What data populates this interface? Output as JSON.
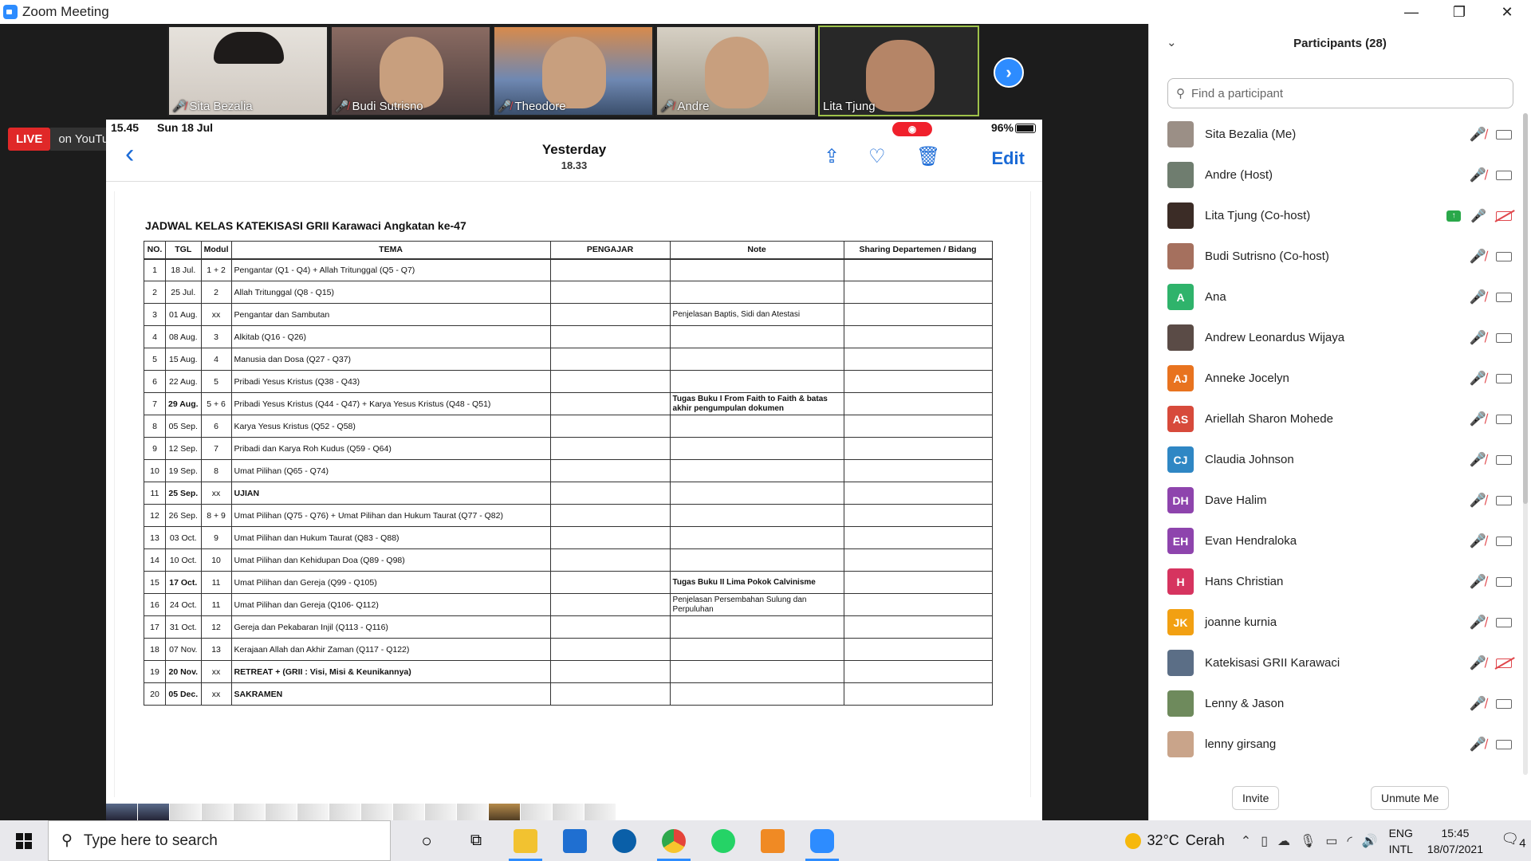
{
  "window": {
    "title": "Zoom Meeting"
  },
  "controls": {
    "minimize": "—",
    "maximize": "❐",
    "close": "✕"
  },
  "gallery": {
    "tiles": [
      {
        "name": "Sita Bezalia",
        "muted": true
      },
      {
        "name": "Budi Sutrisno",
        "muted": true
      },
      {
        "name": "Theodore",
        "muted": true
      },
      {
        "name": "Andre",
        "muted": true
      },
      {
        "name": "Lita Tjung",
        "muted": false
      }
    ],
    "next_icon": "›"
  },
  "live": {
    "badge": "LIVE",
    "platform": "on YouTube"
  },
  "phone": {
    "status_time": "15.45",
    "status_date": "Sun 18 Jul",
    "battery": "96%",
    "nav_title": "Yesterday",
    "nav_subtitle": "18.33",
    "edit": "Edit",
    "back": "‹"
  },
  "document": {
    "title": "JADWAL KELAS KATEKISASI GRII Karawaci Angkatan ke-47",
    "headers": [
      "NO.",
      "TGL",
      "Modul",
      "TEMA",
      "PENGAJAR",
      "Note",
      "Sharing Departemen / Bidang"
    ],
    "rows": [
      {
        "no": "1",
        "tgl": "18 Jul.",
        "modul": "1 + 2",
        "tema": "Pengantar (Q1 - Q4) + Allah Tritunggal (Q5 - Q7)",
        "note": "",
        "bold_tgl": false,
        "bold_tema": false
      },
      {
        "no": "2",
        "tgl": "25 Jul.",
        "modul": "2",
        "tema": "Allah Tritunggal (Q8 - Q15)",
        "note": "",
        "bold_tgl": false,
        "bold_tema": false
      },
      {
        "no": "3",
        "tgl": "01 Aug.",
        "modul": "xx",
        "tema": "Pengantar dan Sambutan",
        "note": "Penjelasan Baptis, Sidi dan Atestasi",
        "bold_tgl": false,
        "bold_tema": false
      },
      {
        "no": "4",
        "tgl": "08 Aug.",
        "modul": "3",
        "tema": "Alkitab (Q16 - Q26)",
        "note": "",
        "bold_tgl": false,
        "bold_tema": false
      },
      {
        "no": "5",
        "tgl": "15 Aug.",
        "modul": "4",
        "tema": "Manusia dan Dosa (Q27 - Q37)",
        "note": "",
        "bold_tgl": false,
        "bold_tema": false
      },
      {
        "no": "6",
        "tgl": "22 Aug.",
        "modul": "5",
        "tema": "Pribadi Yesus Kristus (Q38 - Q43)",
        "note": "",
        "bold_tgl": false,
        "bold_tema": false
      },
      {
        "no": "7",
        "tgl": "29 Aug.",
        "modul": "5 + 6",
        "tema": "Pribadi Yesus Kristus (Q44 - Q47) + Karya Yesus Kristus (Q48 - Q51)",
        "note": "Tugas Buku I From Faith to Faith & batas akhir pengumpulan dokumen",
        "bold_tgl": true,
        "bold_tema": false
      },
      {
        "no": "8",
        "tgl": "05 Sep.",
        "modul": "6",
        "tema": "Karya Yesus Kristus (Q52 - Q58)",
        "note": "",
        "bold_tgl": false,
        "bold_tema": false
      },
      {
        "no": "9",
        "tgl": "12 Sep.",
        "modul": "7",
        "tema": "Pribadi dan Karya Roh Kudus (Q59 - Q64)",
        "note": "",
        "bold_tgl": false,
        "bold_tema": false
      },
      {
        "no": "10",
        "tgl": "19 Sep.",
        "modul": "8",
        "tema": "Umat Pilihan (Q65 - Q74)",
        "note": "",
        "bold_tgl": false,
        "bold_tema": false
      },
      {
        "no": "11",
        "tgl": "25 Sep.",
        "modul": "xx",
        "tema": "UJIAN",
        "note": "",
        "bold_tgl": true,
        "bold_tema": true
      },
      {
        "no": "12",
        "tgl": "26 Sep.",
        "modul": "8 + 9",
        "tema": "Umat Pilihan (Q75 - Q76) + Umat Pilihan dan Hukum Taurat (Q77 - Q82)",
        "note": "",
        "bold_tgl": false,
        "bold_tema": false
      },
      {
        "no": "13",
        "tgl": "03 Oct.",
        "modul": "9",
        "tema": "Umat Pilihan dan Hukum Taurat (Q83 - Q88)",
        "note": "",
        "bold_tgl": false,
        "bold_tema": false
      },
      {
        "no": "14",
        "tgl": "10 Oct.",
        "modul": "10",
        "tema": "Umat Pilihan dan Kehidupan Doa (Q89 - Q98)",
        "note": "",
        "bold_tgl": false,
        "bold_tema": false
      },
      {
        "no": "15",
        "tgl": "17 Oct.",
        "modul": "11",
        "tema": "Umat Pilihan dan Gereja (Q99 - Q105)",
        "note": "Tugas Buku II Lima Pokok Calvinisme",
        "bold_tgl": true,
        "bold_tema": false
      },
      {
        "no": "16",
        "tgl": "24 Oct.",
        "modul": "11",
        "tema": "Umat Pilihan dan Gereja (Q106- Q112)",
        "note": "Penjelasan Persembahan Sulung dan Perpuluhan",
        "bold_tgl": false,
        "bold_tema": false
      },
      {
        "no": "17",
        "tgl": "31 Oct.",
        "modul": "12",
        "tema": "Gereja dan Pekabaran Injil (Q113 - Q116)",
        "note": "",
        "bold_tgl": false,
        "bold_tema": false
      },
      {
        "no": "18",
        "tgl": "07 Nov.",
        "modul": "13",
        "tema": "Kerajaan Allah dan Akhir Zaman (Q117 - Q122)",
        "note": "",
        "bold_tgl": false,
        "bold_tema": false
      },
      {
        "no": "19",
        "tgl": "20 Nov.",
        "modul": "xx",
        "tema": "RETREAT + (GRII : Visi, Misi & Keunikannya)",
        "note": "",
        "bold_tgl": true,
        "bold_tema": true
      },
      {
        "no": "20",
        "tgl": "05 Dec.",
        "modul": "xx",
        "tema": "SAKRAMEN",
        "note": "",
        "bold_tgl": true,
        "bold_tema": true
      }
    ]
  },
  "participants": {
    "header": "Participants (28)",
    "search_placeholder": "Find a participant",
    "list": [
      {
        "name": "Sita Bezalia (Me)",
        "initials": "",
        "color": "#9b8f86",
        "mic": "off",
        "video": "on"
      },
      {
        "name": "Andre (Host)",
        "initials": "",
        "color": "#6f7d6f",
        "mic": "off",
        "video": "on"
      },
      {
        "name": "Lita Tjung (Co-host)",
        "initials": "",
        "color": "#3b2c26",
        "mic": "on",
        "video": "off",
        "sharing": true
      },
      {
        "name": "Budi Sutrisno (Co-host)",
        "initials": "",
        "color": "#a5705e",
        "mic": "off",
        "video": "on"
      },
      {
        "name": "Ana",
        "initials": "A",
        "color": "#2fb36b",
        "mic": "off",
        "video": "on"
      },
      {
        "name": "Andrew Leonardus Wijaya",
        "initials": "",
        "color": "#5a4b46",
        "mic": "off",
        "video": "on"
      },
      {
        "name": "Anneke Jocelyn",
        "initials": "AJ",
        "color": "#e8731f",
        "mic": "off",
        "video": "on"
      },
      {
        "name": "Ariellah Sharon Mohede",
        "initials": "AS",
        "color": "#d74a3b",
        "mic": "off",
        "video": "on"
      },
      {
        "name": "Claudia Johnson",
        "initials": "CJ",
        "color": "#2f87c4",
        "mic": "off",
        "video": "on"
      },
      {
        "name": "Dave Halim",
        "initials": "DH",
        "color": "#8e44ad",
        "mic": "off",
        "video": "on"
      },
      {
        "name": "Evan Hendraloka",
        "initials": "EH",
        "color": "#8e44ad",
        "mic": "off",
        "video": "on"
      },
      {
        "name": "Hans Christian",
        "initials": "H",
        "color": "#d6345f",
        "mic": "off",
        "video": "on"
      },
      {
        "name": "joanne kurnia",
        "initials": "JK",
        "color": "#f2a012",
        "mic": "off",
        "video": "on"
      },
      {
        "name": "Katekisasi GRII Karawaci",
        "initials": "",
        "color": "#5b6e86",
        "mic": "off",
        "video": "off"
      },
      {
        "name": "Lenny & Jason",
        "initials": "",
        "color": "#6e8a5c",
        "mic": "off",
        "video": "on"
      },
      {
        "name": "lenny girsang",
        "initials": "",
        "color": "#c9a48a",
        "mic": "off",
        "video": "on"
      }
    ],
    "invite": "Invite",
    "unmute": "Unmute Me"
  },
  "taskbar": {
    "search_placeholder": "Type here to search",
    "weather_temp": "32°C",
    "weather_desc": "Cerah",
    "lang1": "ENG",
    "lang2": "INTL",
    "time": "15:45",
    "date": "18/07/2021",
    "notifications": "4"
  }
}
